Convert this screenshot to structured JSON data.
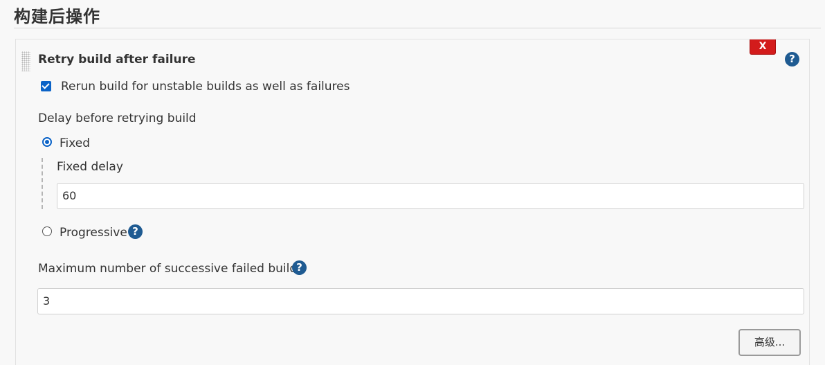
{
  "section": {
    "title": "构建后操作"
  },
  "card": {
    "title": "Retry build after failure",
    "delete_label": "X",
    "help_glyph": "?"
  },
  "rerun_checkbox": {
    "checked": true,
    "label": "Rerun build for unstable builds as well as failures"
  },
  "delay": {
    "label": "Delay before retrying build",
    "options": [
      {
        "label": "Fixed",
        "selected": true
      },
      {
        "label": "Progressive",
        "selected": false
      }
    ],
    "fixed_delay_label": "Fixed delay",
    "fixed_delay_value": "60"
  },
  "max_failed": {
    "label": "Maximum number of successive failed builds",
    "value": "3"
  },
  "advanced_button": {
    "label": "高级..."
  },
  "icons": {
    "help": "question-circle-icon",
    "delete": "close-icon",
    "drag": "drag-handle-icon"
  },
  "colors": {
    "accent": "#0b63c7",
    "help_icon": "#1f5b92",
    "delete": "#d31c1c"
  }
}
